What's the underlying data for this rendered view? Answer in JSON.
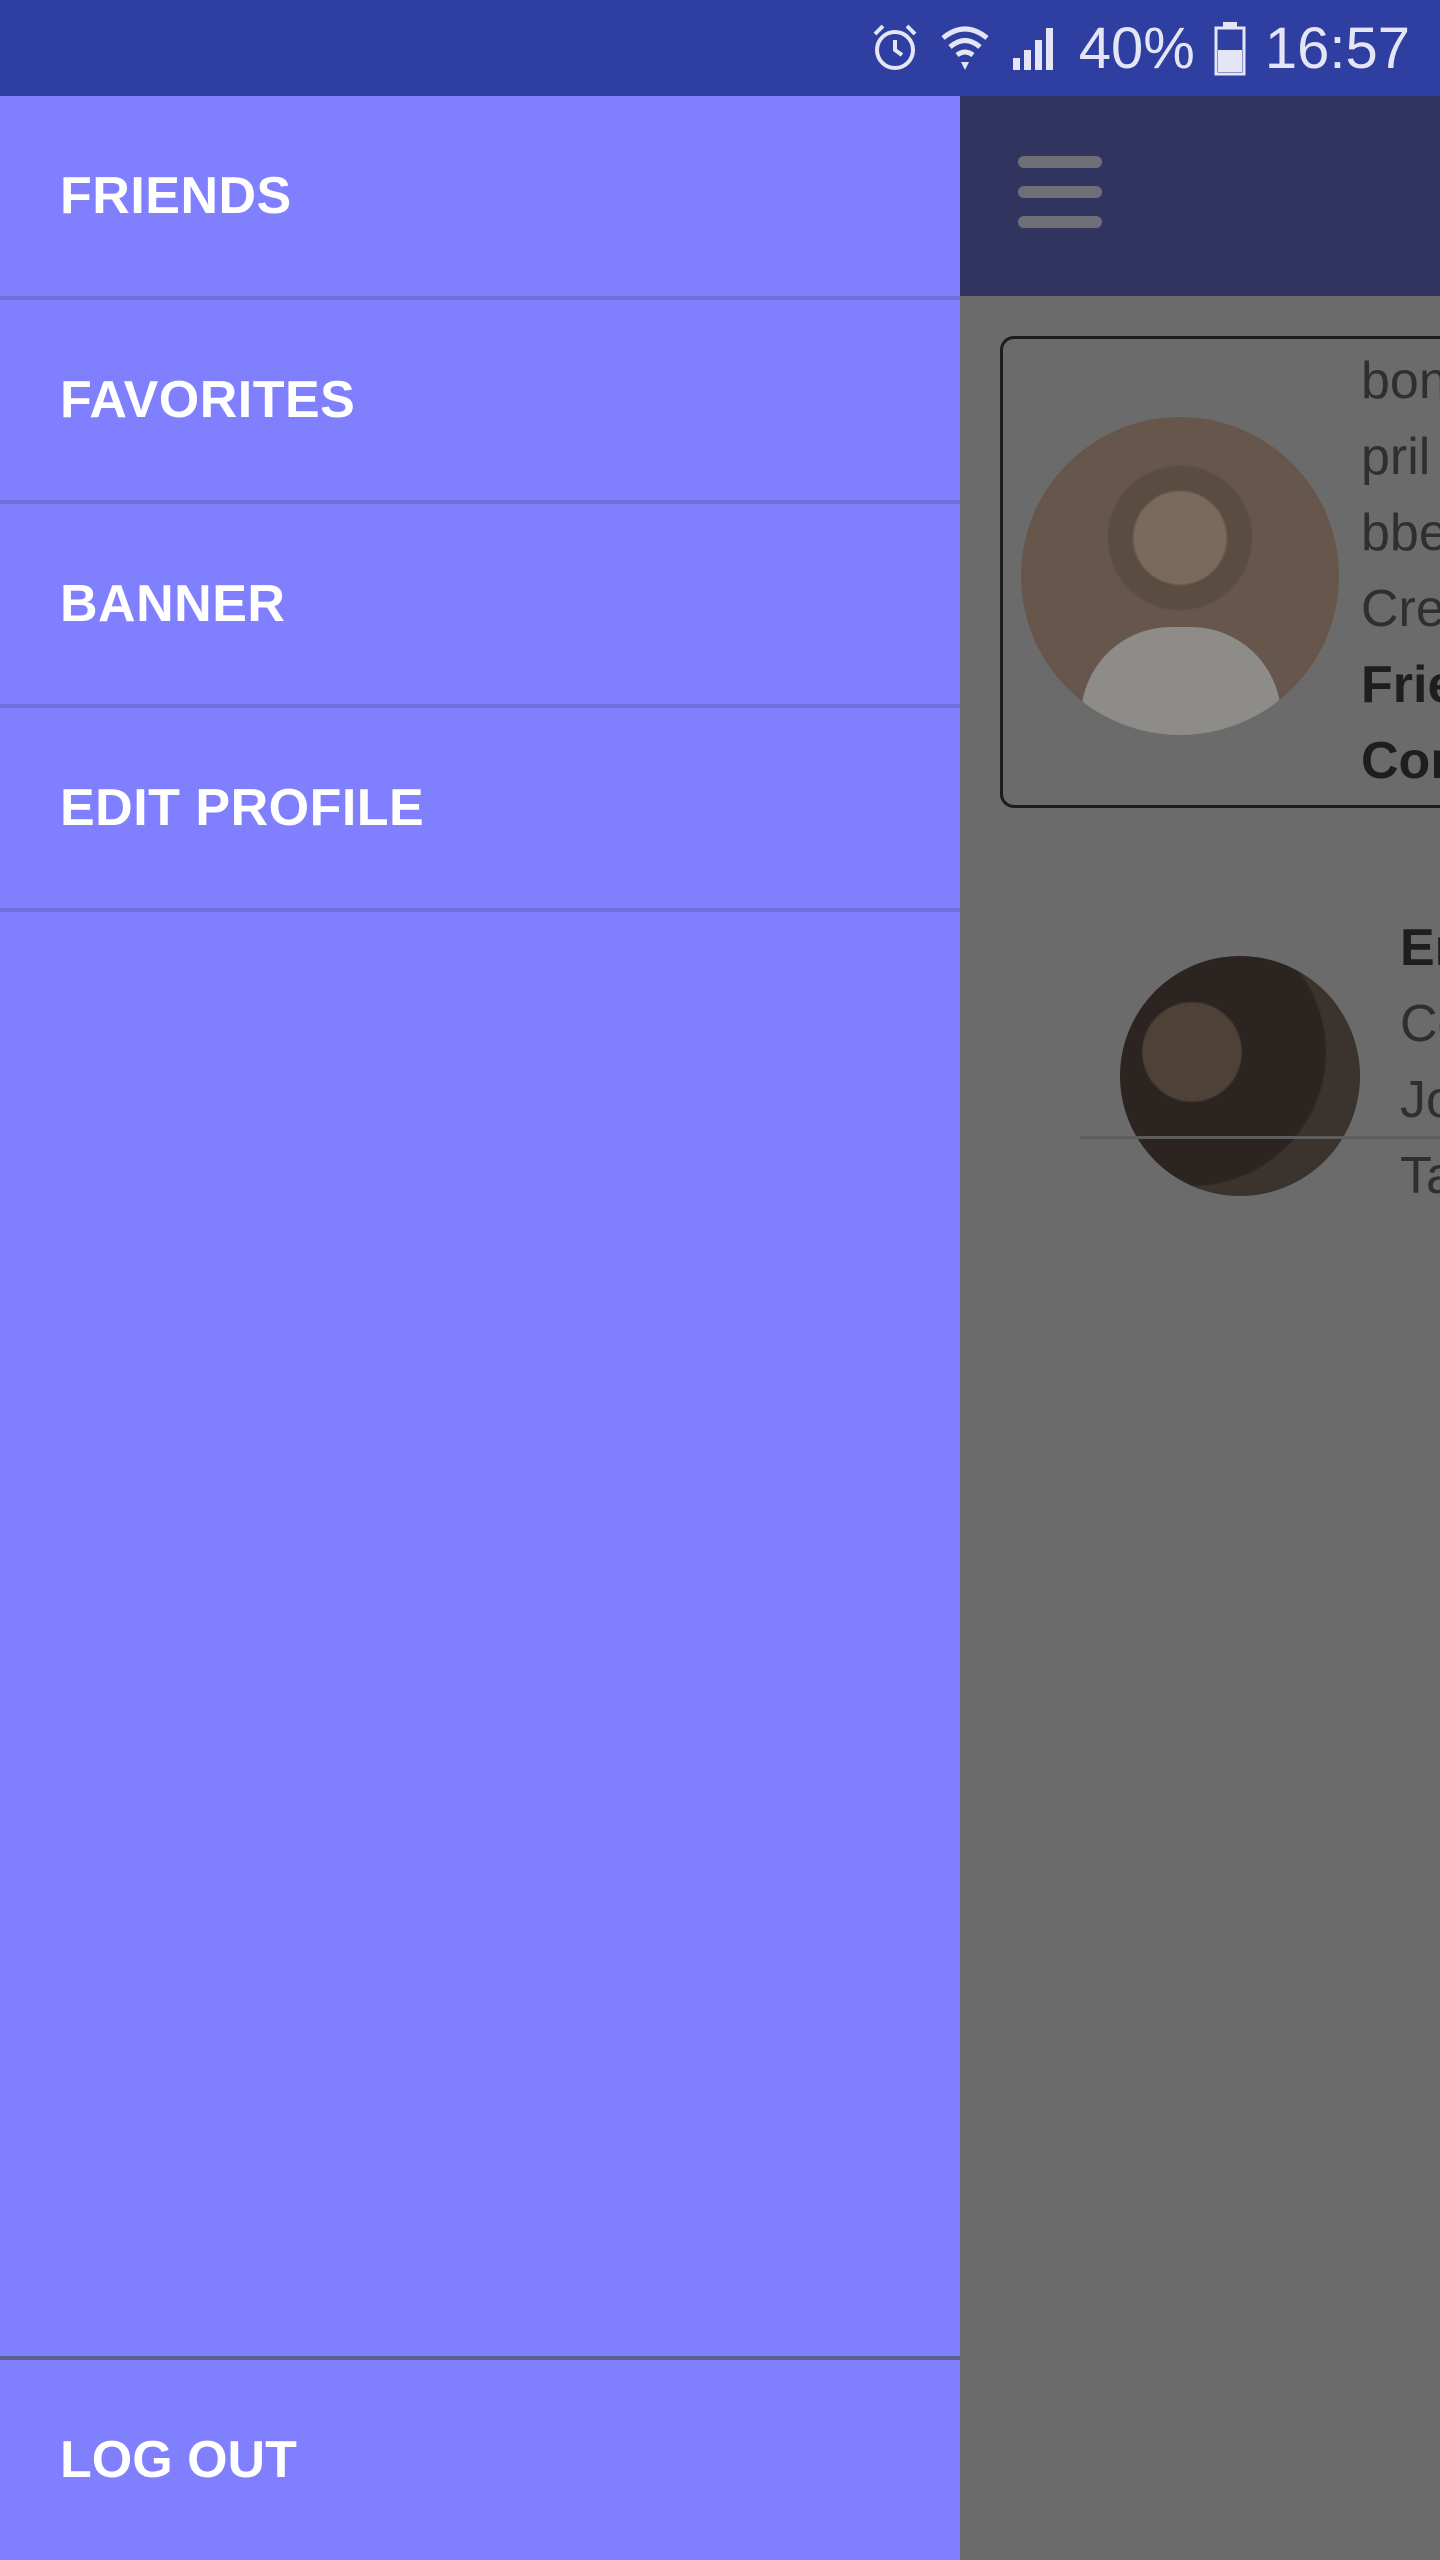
{
  "status_bar": {
    "battery_percent": "40%",
    "time": "16:57",
    "icons": [
      "alarm-icon",
      "wifi-icon",
      "signal-icon",
      "battery-icon"
    ]
  },
  "drawer": {
    "items": [
      {
        "label": "FRIENDS"
      },
      {
        "label": "FAVORITES"
      },
      {
        "label": "BANNER"
      },
      {
        "label": "EDIT PROFILE"
      }
    ],
    "logout_label": "LOG OUT",
    "background_color": "#8080ff"
  },
  "background_app": {
    "profile_card": {
      "lines": [
        "bon",
        "pril",
        "bbe",
        "Cre"
      ],
      "bold_lines": [
        "Frie",
        "Cor"
      ]
    },
    "friend_row": {
      "bold_line": "Er",
      "lines": [
        "Co",
        "Jo",
        "Ta"
      ]
    }
  }
}
